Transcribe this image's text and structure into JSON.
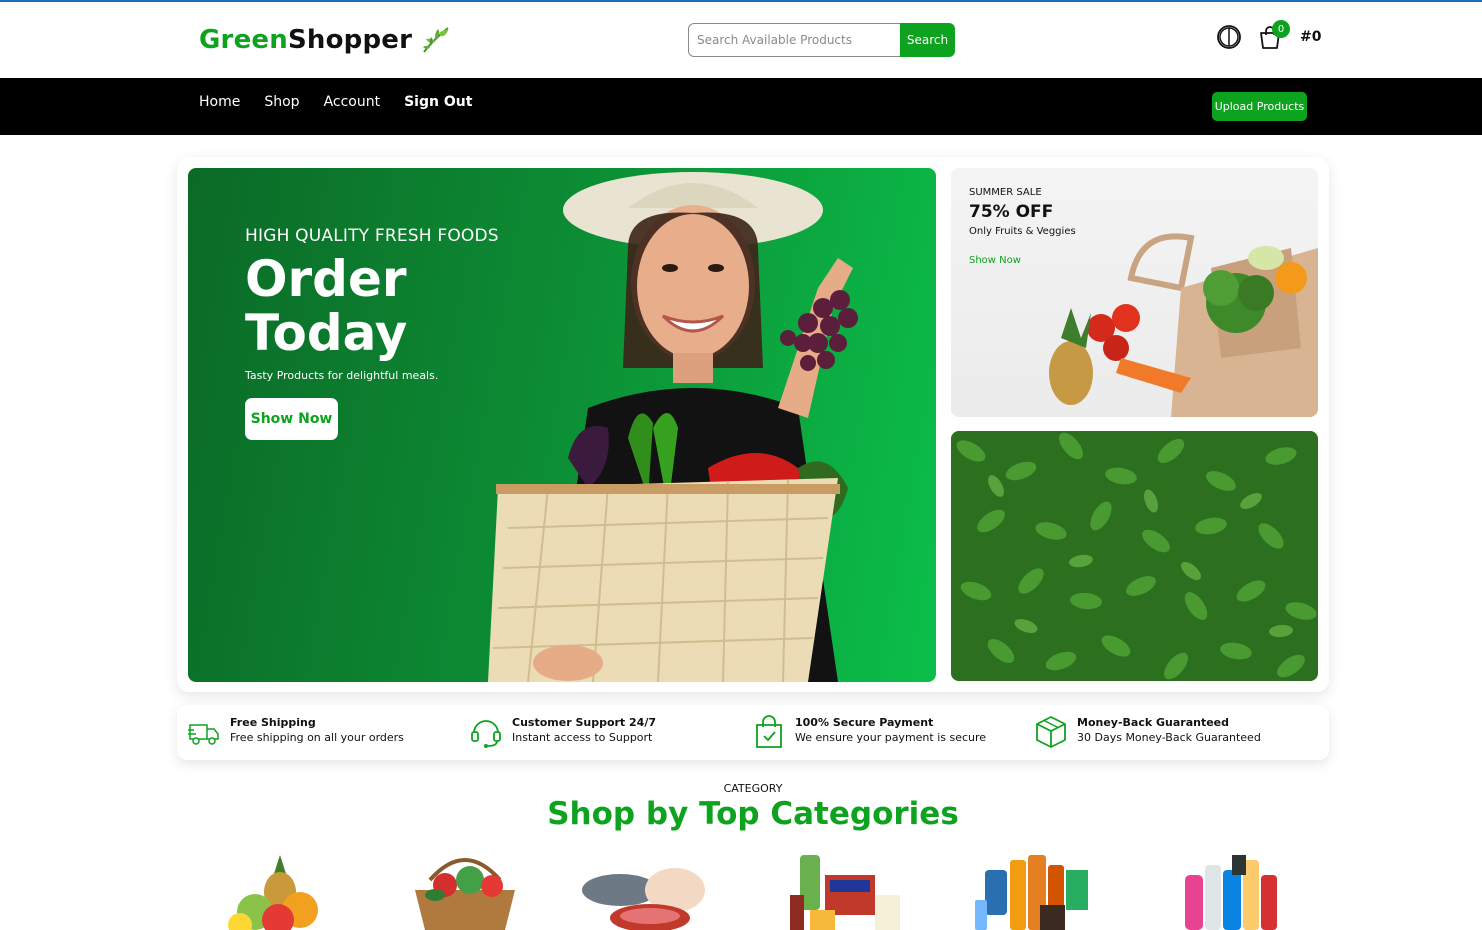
{
  "header": {
    "logo_green": "Green",
    "logo_dark": "Shopper",
    "search_placeholder": "Search Available Products",
    "search_button": "Search",
    "cart_count": "0",
    "cart_total": "#0"
  },
  "nav": {
    "items": [
      {
        "label": "Home"
      },
      {
        "label": "Shop"
      },
      {
        "label": "Account"
      },
      {
        "label": "Sign Out"
      }
    ],
    "upload_button": "Upload Products"
  },
  "hero": {
    "subtitle": "HIGH QUALITY FRESH FOODS",
    "title": "Order Today",
    "description": "Tasty Products for delightful meals.",
    "button": "Show Now"
  },
  "promo": {
    "tag": "SUMMER SALE",
    "offer": "75% OFF",
    "description": "Only Fruits & Veggies",
    "link": "Show Now"
  },
  "features": [
    {
      "title": "Free Shipping",
      "desc": "Free shipping on all your orders"
    },
    {
      "title": "Customer Support 24/7",
      "desc": "Instant access to Support"
    },
    {
      "title": "100% Secure Payment",
      "desc": "We ensure your payment is secure"
    },
    {
      "title": "Money-Back Guaranteed",
      "desc": "30 Days Money-Back Guaranteed"
    }
  ],
  "categories": {
    "label": "CATEGORY",
    "title": "Shop by Top Categories"
  },
  "colors": {
    "brand_green": "#0ea31f",
    "nav_bg": "#000000"
  }
}
